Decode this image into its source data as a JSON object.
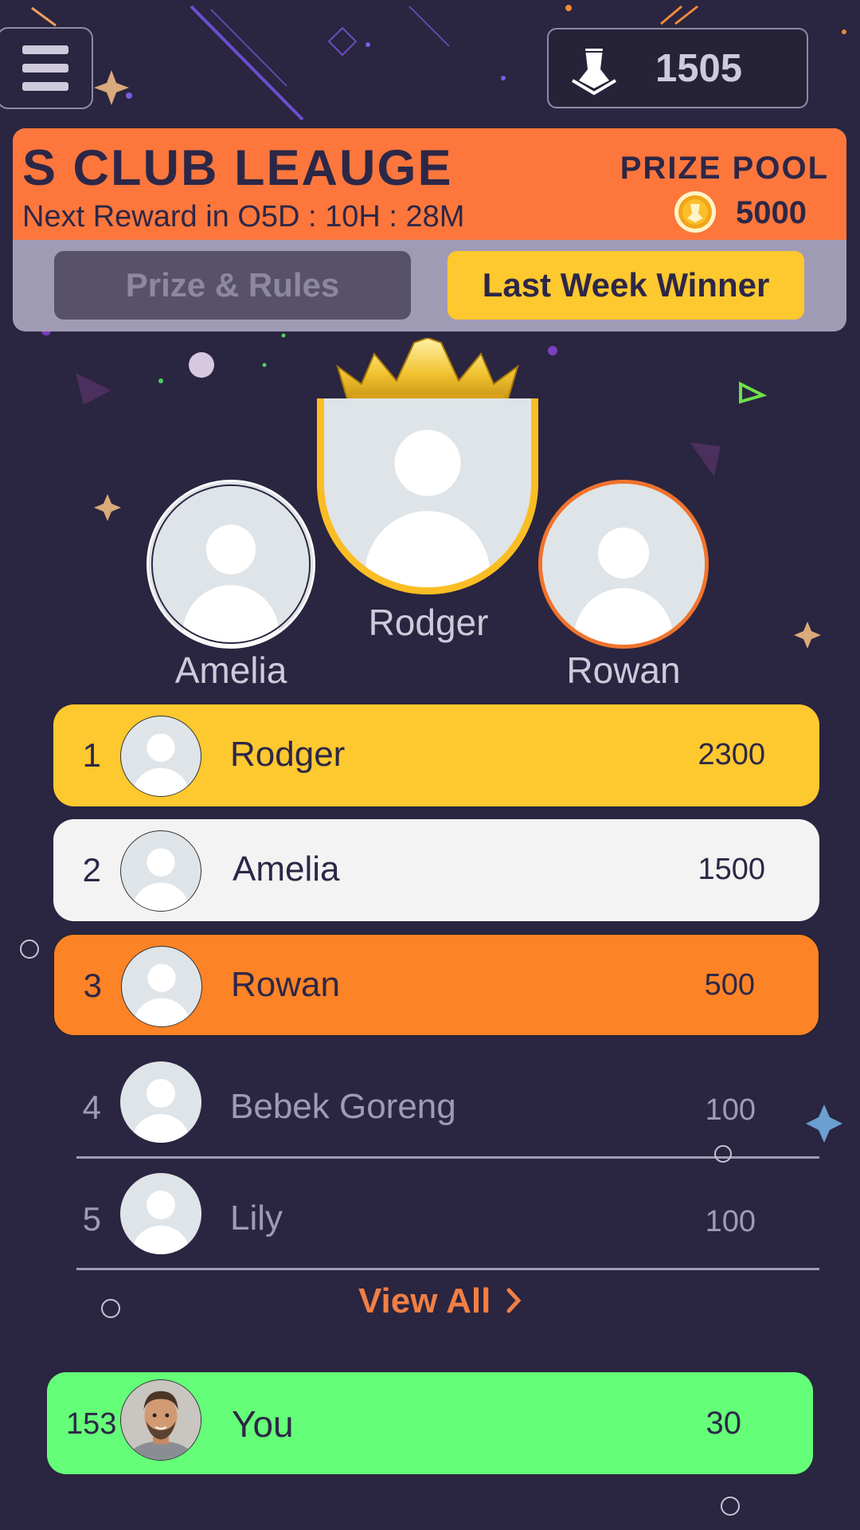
{
  "header": {
    "coins": "1505"
  },
  "league": {
    "title": "S CLUB LEAUGE",
    "next_reward": "Next Reward in O5D : 10H : 28M",
    "prize_label": "PRIZE POOL",
    "prize_value": "5000",
    "tabs": {
      "rules": "Prize & Rules",
      "winner": "Last Week Winner"
    }
  },
  "podium": {
    "first": "Rodger",
    "second": "Amelia",
    "third": "Rowan"
  },
  "leaderboard": [
    {
      "rank": "1",
      "name": "Rodger",
      "score": "2300"
    },
    {
      "rank": "2",
      "name": "Amelia",
      "score": "1500"
    },
    {
      "rank": "3",
      "name": "Rowan",
      "score": "500"
    },
    {
      "rank": "4",
      "name": "Bebek Goreng",
      "score": "100"
    },
    {
      "rank": "5",
      "name": "Lily",
      "score": "100"
    }
  ],
  "view_all": "View All",
  "you": {
    "rank": "153",
    "name": "You",
    "score": "30"
  },
  "colors": {
    "background": "#2a2540",
    "league_orange": "#fd773d",
    "gold": "#fec82f",
    "second_row": "#f3f3f3",
    "third_row": "#fd8327",
    "you_row": "#65fe78"
  },
  "icons": {
    "menu": "hamburger-menu-icon",
    "coins": "chess-piece-icon",
    "prize": "coin-icon",
    "crown": "crown-icon",
    "avatar": "user-avatar-icon",
    "chevron": "chevron-right-icon"
  }
}
